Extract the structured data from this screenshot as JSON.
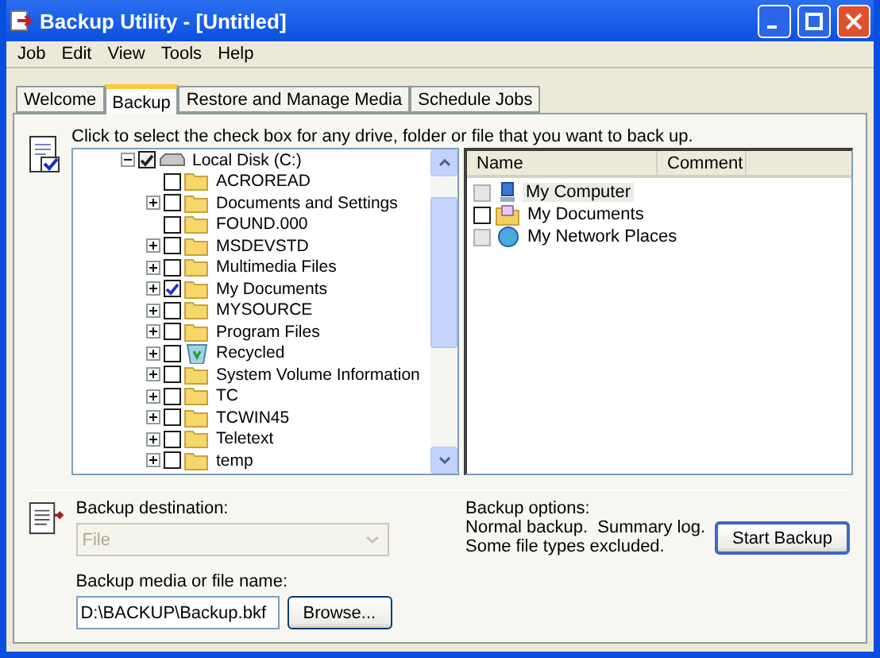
{
  "window": {
    "title": "Backup Utility - [Untitled]"
  },
  "menu": [
    "Job",
    "Edit",
    "View",
    "Tools",
    "Help"
  ],
  "tabs": [
    {
      "label": "Welcome",
      "selected": false
    },
    {
      "label": "Backup",
      "selected": true
    },
    {
      "label": "Restore and Manage Media",
      "selected": false
    },
    {
      "label": "Schedule Jobs",
      "selected": false
    }
  ],
  "instruction": "Click to select the check box for any drive, folder or file that you want to back up.",
  "tree": {
    "label": "Local Disk (C:)",
    "kind": "drive",
    "checked": true,
    "expanded": true,
    "children": [
      {
        "label": "ACROREAD",
        "kind": "folder",
        "checked": false,
        "expandable": false
      },
      {
        "label": "Documents and Settings",
        "kind": "folder",
        "checked": false,
        "expandable": true
      },
      {
        "label": "FOUND.000",
        "kind": "folder",
        "checked": false,
        "expandable": false
      },
      {
        "label": "MSDEVSTD",
        "kind": "folder",
        "checked": false,
        "expandable": true
      },
      {
        "label": "Multimedia Files",
        "kind": "folder",
        "checked": false,
        "expandable": true
      },
      {
        "label": "My Documents",
        "kind": "folder",
        "checked": true,
        "expandable": true
      },
      {
        "label": "MYSOURCE",
        "kind": "folder",
        "checked": false,
        "expandable": true
      },
      {
        "label": "Program Files",
        "kind": "folder",
        "checked": false,
        "expandable": true
      },
      {
        "label": "Recycled",
        "kind": "recycle",
        "checked": false,
        "expandable": true
      },
      {
        "label": "System Volume Information",
        "kind": "folder",
        "checked": false,
        "expandable": true
      },
      {
        "label": "TC",
        "kind": "folder",
        "checked": false,
        "expandable": true
      },
      {
        "label": "TCWIN45",
        "kind": "folder",
        "checked": false,
        "expandable": true
      },
      {
        "label": "Teletext",
        "kind": "folder",
        "checked": false,
        "expandable": true
      },
      {
        "label": "temp",
        "kind": "folder",
        "checked": false,
        "expandable": true
      }
    ]
  },
  "list": {
    "columns": [
      "Name",
      "Comment"
    ],
    "rows": [
      {
        "name": "My Computer",
        "kind": "computer",
        "disabled": true,
        "selected": true
      },
      {
        "name": "My Documents",
        "kind": "documents",
        "disabled": false,
        "selected": false
      },
      {
        "name": "My Network Places",
        "kind": "network",
        "disabled": true,
        "selected": false
      }
    ]
  },
  "destination": {
    "label": "Backup destination:",
    "value": "File",
    "disabled": true
  },
  "media": {
    "label": "Backup media or file name:",
    "value": "D:\\BACKUP\\Backup.bkf"
  },
  "browse_button": "Browse...",
  "options": {
    "label": "Backup options:",
    "lines": [
      "Normal backup.  Summary log.",
      "Some file types excluded."
    ]
  },
  "start_button": "Start Backup"
}
